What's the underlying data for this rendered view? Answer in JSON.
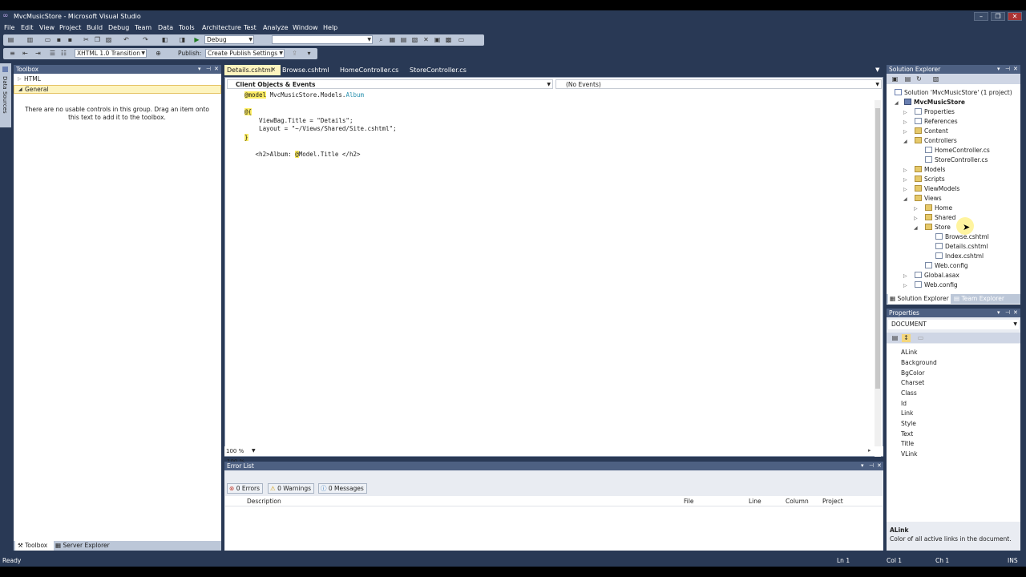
{
  "window": {
    "title": "MvcMusicStore - Microsoft Visual Studio"
  },
  "menu": [
    "File",
    "Edit",
    "View",
    "Project",
    "Build",
    "Debug",
    "Team",
    "Data",
    "Tools",
    "Architecture",
    "Test",
    "Analyze",
    "Window",
    "Help"
  ],
  "toolbar1": {
    "config": "Debug",
    "platform": ""
  },
  "toolbar2": {
    "doctype": "XHTML 1.0 Transition",
    "publish_label": "Publish:",
    "publish_value": "Create Publish Settings"
  },
  "side_strip": {
    "label": "Data Sources"
  },
  "toolbox": {
    "title": "Toolbox",
    "groups": [
      "HTML",
      "General"
    ],
    "empty_message": "There are no usable controls in this group. Drag an item onto this text to add it to the toolbox.",
    "bottom_tabs": [
      "Toolbox",
      "Server Explorer"
    ]
  },
  "editor": {
    "tabs": [
      "Details.cshtml",
      "Browse.cshtml",
      "HomeController.cs",
      "StoreController.cs"
    ],
    "objects_dropdown": "Client Objects & Events",
    "events_dropdown": "(No Events)",
    "code": {
      "l1_kw": "@model",
      "l1_ns": " MvcMusicStore.Models.",
      "l1_type": "Album",
      "l2": "@{",
      "l3": "    ViewBag.Title = \"Details\";",
      "l4": "    Layout = \"~/Views/Shared/Site.cshtml\";",
      "l5": "}",
      "l6_a": "   <h2>Album: ",
      "l6_b": "@",
      "l6_c": "Model.Title </h2>"
    },
    "zoom": "100 %"
  },
  "error_list": {
    "title": "Error List",
    "errors": "0 Errors",
    "warnings": "0 Warnings",
    "messages": "0 Messages",
    "columns": [
      "Description",
      "File",
      "Line",
      "Column",
      "Project"
    ]
  },
  "solution_explorer": {
    "title": "Solution Explorer",
    "solution": "Solution 'MvcMusicStore' (1 project)",
    "project": "MvcMusicStore",
    "items": {
      "properties": "Properties",
      "references": "References",
      "content": "Content",
      "controllers": "Controllers",
      "home_controller": "HomeController.cs",
      "store_controller": "StoreController.cs",
      "models": "Models",
      "scripts": "Scripts",
      "viewmodels": "ViewModels",
      "views": "Views",
      "home": "Home",
      "shared": "Shared",
      "store": "Store",
      "browse": "Browse.cshtml",
      "details": "Details.cshtml",
      "index": "Index.cshtml",
      "views_webconfig": "Web.config",
      "global": "Global.asax",
      "webconfig": "Web.config"
    },
    "bottom_tabs": [
      "Solution Explorer",
      "Team Explorer"
    ]
  },
  "properties": {
    "title": "Properties",
    "object": "DOCUMENT",
    "items": [
      "ALink",
      "Background",
      "BgColor",
      "Charset",
      "Class",
      "Id",
      "Link",
      "Style",
      "Text",
      "Title",
      "VLink"
    ],
    "desc_title": "ALink",
    "desc_text": "Color of all active links in the document."
  },
  "status": {
    "ready": "Ready",
    "ln": "Ln 1",
    "col": "Col 1",
    "ch": "Ch 1",
    "ins": "INS"
  },
  "colors": {
    "chrome": "#293955",
    "panel_title": "#4d6082",
    "active_tab": "#fdf4bf",
    "razor_highlight": "#ffee62"
  }
}
